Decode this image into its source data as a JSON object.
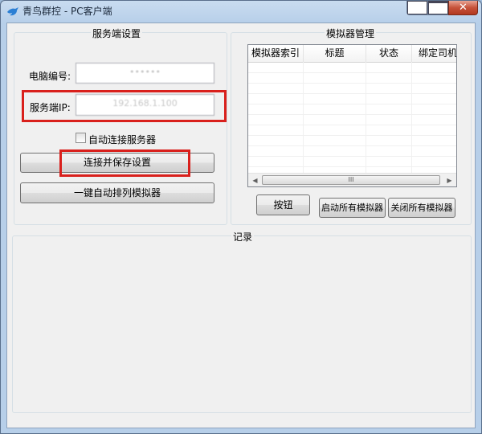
{
  "window": {
    "title": "青鸟群控 - PC客户端"
  },
  "server_settings": {
    "title": "服务端设置",
    "pc_id_label": "电脑编号:",
    "pc_id_value": "••••••",
    "server_ip_label": "服务端IP:",
    "server_ip_value": "192.168.1.100",
    "auto_connect_label": "自动连接服务器",
    "auto_connect_checked": false,
    "connect_save_button": "连接并保存设置",
    "arrange_button": "一键自动排列模拟器"
  },
  "emulator_manager": {
    "title": "模拟器管理",
    "columns": [
      "模拟器索引",
      "标题",
      "状态",
      "绑定司机"
    ],
    "rows": [],
    "scrollbar_thumb": "III",
    "button_label": "按钮",
    "start_all_button": "启动所有模拟器",
    "close_all_button": "关闭所有模拟器"
  },
  "log": {
    "title": "记录"
  },
  "colors": {
    "highlight": "#d9201c"
  }
}
